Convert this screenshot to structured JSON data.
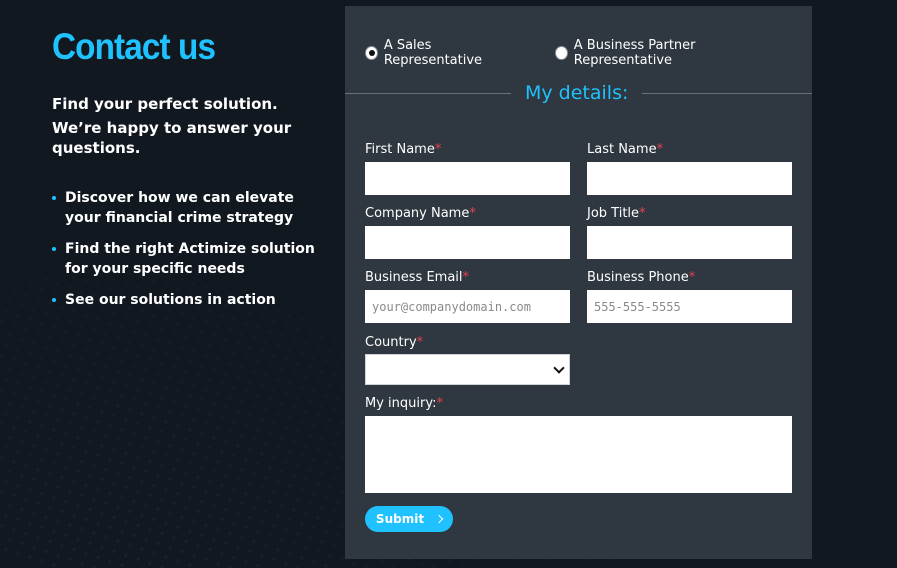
{
  "left": {
    "title": "Contact us",
    "intro_line1": "Find your perfect solution.",
    "intro_line2": "We’re happy to answer your questions.",
    "bullets": [
      "Discover how we can elevate your financial crime strategy",
      "Find the right Actimize solution for your specific needs",
      "See our solutions in action"
    ]
  },
  "form": {
    "radios": [
      {
        "label": "A Sales Representative",
        "checked": true
      },
      {
        "label": "A Business Partner Representative",
        "checked": false
      }
    ],
    "section_title": "My details:",
    "required_mark": "*",
    "fields": {
      "first_name": {
        "label": "First Name",
        "placeholder": ""
      },
      "last_name": {
        "label": "Last Name",
        "placeholder": ""
      },
      "company_name": {
        "label": "Company Name",
        "placeholder": ""
      },
      "job_title": {
        "label": "Job Title",
        "placeholder": ""
      },
      "business_email": {
        "label": "Business Email",
        "placeholder": "your@companydomain.com"
      },
      "business_phone": {
        "label": "Business Phone",
        "placeholder": "555-555-5555"
      },
      "country": {
        "label": "Country",
        "selected": ""
      },
      "inquiry": {
        "label": "My inquiry:",
        "placeholder": ""
      }
    },
    "submit_label": "Submit"
  },
  "colors": {
    "accent": "#1fc2ff",
    "panel": "#2f3740",
    "background": "#111820",
    "required": "#e8424f"
  }
}
